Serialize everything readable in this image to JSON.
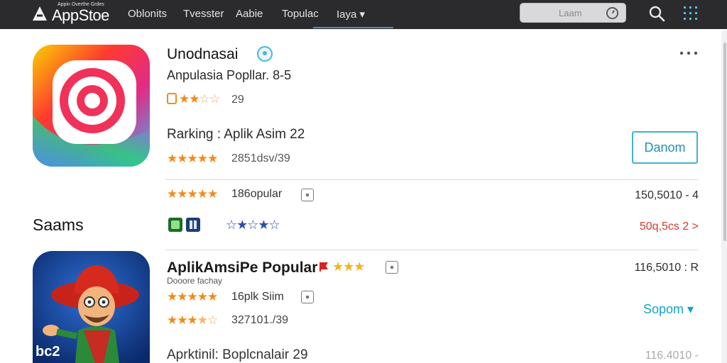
{
  "header": {
    "logo_subtitle": "Appin Overthe Grdes",
    "logo_text": "AppStoe",
    "nav": [
      "Oblonits",
      "Tvesster",
      "Aabie",
      "Topulac",
      "Iaya ▾"
    ],
    "search_placeholder": "Laam"
  },
  "featured": {
    "title": "Unodnasai",
    "subtitle": "Anpulasia  Popllar.  8-5",
    "rating_count": "29",
    "ranking": "Rarking : Aplik Asim    22",
    "rating2_count": "2851dsv/39",
    "action_button": "Danom",
    "popular_label": "186opular",
    "popular_value": "150,5010 - 4",
    "sub_value": "50q,5cs 2 >"
  },
  "section": {
    "heading": "Saams"
  },
  "row2": {
    "title": "AplikAmsiPe Popular",
    "subtitle": "Dooore fachay",
    "line_label": "16plk Siim",
    "rating_count": "327101./39",
    "value_top": "116,5010 : R",
    "action": "Sopom ▾",
    "icon_text": "bc2"
  },
  "row3": {
    "title": "Aprktinil:  Boplcnalair    29",
    "value": "116.4010 -"
  },
  "colors": {
    "accent": "#16a3cc",
    "star": "#f08a1c",
    "sale": "#d9382e"
  }
}
